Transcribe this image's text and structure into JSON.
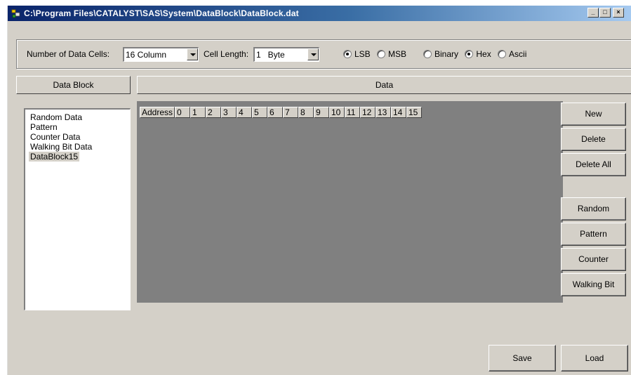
{
  "window": {
    "title": "C:\\Program Files\\CATALYST\\SAS\\System\\DataBlock\\DataBlock.dat",
    "minimize_label": "_",
    "maximize_label": "□",
    "close_label": "×"
  },
  "settings": {
    "num_cells_label": "Number of Data Cells:",
    "num_cells_value": "16 Column",
    "cell_length_label": "Cell Length:",
    "cell_length_value": "1   Byte",
    "bit_order": {
      "options": [
        "LSB",
        "MSB"
      ],
      "selected": "LSB"
    },
    "format": {
      "options": [
        "Binary",
        "Hex",
        "Ascii"
      ],
      "selected": "Hex"
    }
  },
  "data_block_header": "Data Block",
  "data_header": "Data",
  "data_blocks": [
    "Random Data",
    "Pattern",
    "Counter Data",
    "Walking Bit Data",
    "DataBlock15"
  ],
  "selected_block": "DataBlock15",
  "grid": {
    "address_header": "Address",
    "columns": [
      "0",
      "1",
      "2",
      "3",
      "4",
      "5",
      "6",
      "7",
      "8",
      "9",
      "10",
      "11",
      "12",
      "13",
      "14",
      "15"
    ]
  },
  "buttons": {
    "new": "New",
    "delete": "Delete",
    "delete_all": "Delete All",
    "random": "Random",
    "pattern": "Pattern",
    "counter": "Counter",
    "walking_bit": "Walking Bit",
    "save": "Save",
    "load": "Load"
  },
  "colors": {
    "dialog_bg": "#d4d0c8",
    "grid_bg": "#808080",
    "titlebar_start": "#0a246a",
    "titlebar_end": "#a6caf0"
  }
}
